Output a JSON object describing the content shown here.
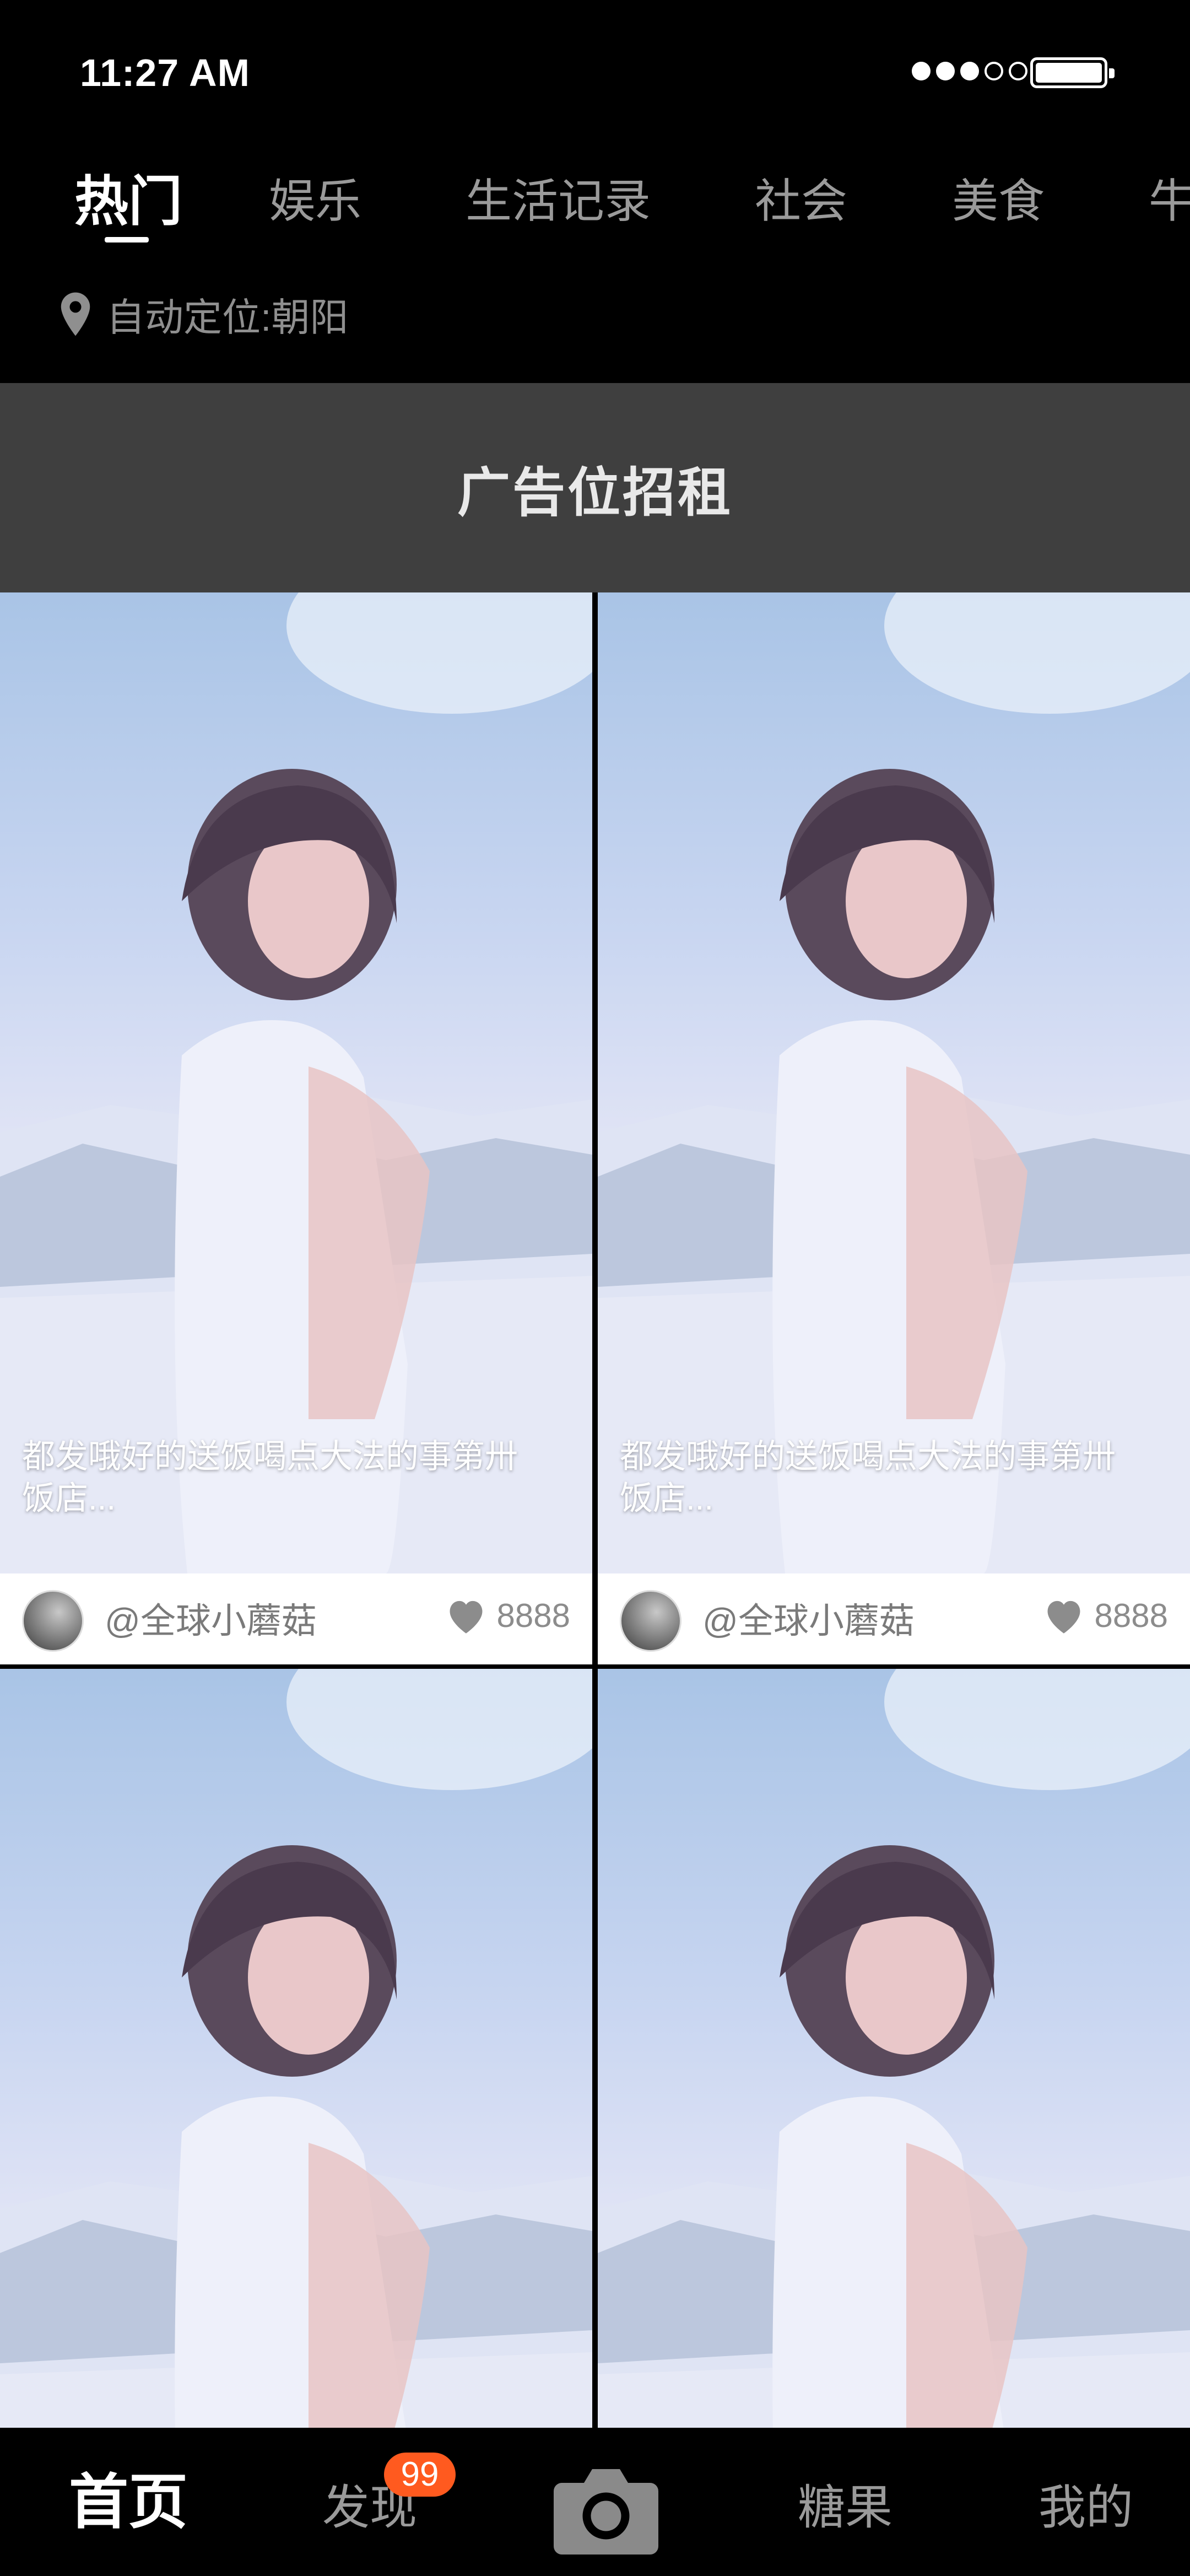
{
  "status_bar": {
    "time": "11:27 AM",
    "signal_dots_filled": 3,
    "signal_dots_total": 5,
    "battery_level": 1.0
  },
  "tabs": [
    {
      "label": "热门",
      "active": true
    },
    {
      "label": "娱乐",
      "active": false
    },
    {
      "label": "生活记录",
      "active": false
    },
    {
      "label": "社会",
      "active": false
    },
    {
      "label": "美食",
      "active": false
    },
    {
      "label": "牛",
      "active": false
    }
  ],
  "location": {
    "text": "自动定位:朝阳",
    "icon": "location-pin-icon"
  },
  "ad_banner": {
    "text": "广告位招租"
  },
  "feed": {
    "cards": [
      {
        "caption": "都发哦好的送饭喝点大法的事第卅饭店...",
        "username": "@全球小蘑菇",
        "likes": "8888"
      },
      {
        "caption": "都发哦好的送饭喝点大法的事第卅饭店...",
        "username": "@全球小蘑菇",
        "likes": "8888"
      },
      {
        "caption": "",
        "username": "",
        "likes": ""
      },
      {
        "caption": "",
        "username": "",
        "likes": ""
      }
    ]
  },
  "bottom_nav": {
    "home": "首页",
    "discover": "发现",
    "discover_badge": "99",
    "camera_icon": "camera-icon",
    "candy": "糖果",
    "mine": "我的"
  },
  "colors": {
    "background": "#000000",
    "ad_background": "#3f3f3f",
    "badge": "#ff5a1f",
    "inactive_text": "#9a9a9a"
  }
}
